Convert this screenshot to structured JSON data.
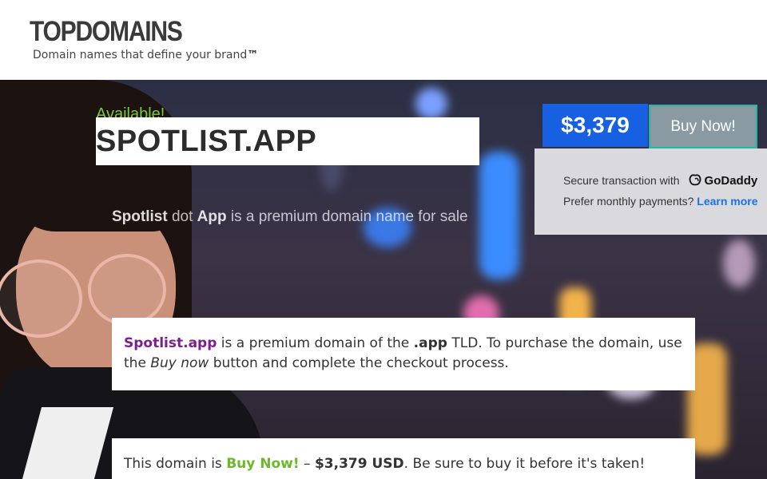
{
  "header": {
    "logo": "TOPDOMAINS",
    "tagline": "Domain names that define your brand",
    "tagline_tm": "™"
  },
  "domain": {
    "available_label": "Available!",
    "name": "SPOTLIST.APP"
  },
  "purchase": {
    "price": "$3,379",
    "buy_label": "Buy Now!",
    "secure_text": "Secure transaction with",
    "provider": "GoDaddy",
    "monthly_text": "Prefer monthly payments?",
    "learn_more": "Learn more"
  },
  "subtitle": {
    "word1": "Spotlist",
    "connector": "dot",
    "word2": "App",
    "rest": "is a premium domain name for sale"
  },
  "info_card": {
    "brand": "Spotlist.app",
    "text1": "is a premium domain of the",
    "tld": ".app",
    "text2": "TLD. To purchase the domain, use the",
    "buy_now_em": "Buy now",
    "text3": "button and complete the checkout process."
  },
  "price_card": {
    "text1": "This domain is",
    "buy_now": "Buy Now!",
    "dash": "–",
    "price_usd": "$3,379 USD",
    "text2": ". Be sure to buy it before it's taken!"
  },
  "colors": {
    "accent_blue": "#1660e1",
    "available_green": "#7ac93a",
    "brand_purple": "#7a1f8c",
    "buy_teal_border": "#29b3a5"
  }
}
